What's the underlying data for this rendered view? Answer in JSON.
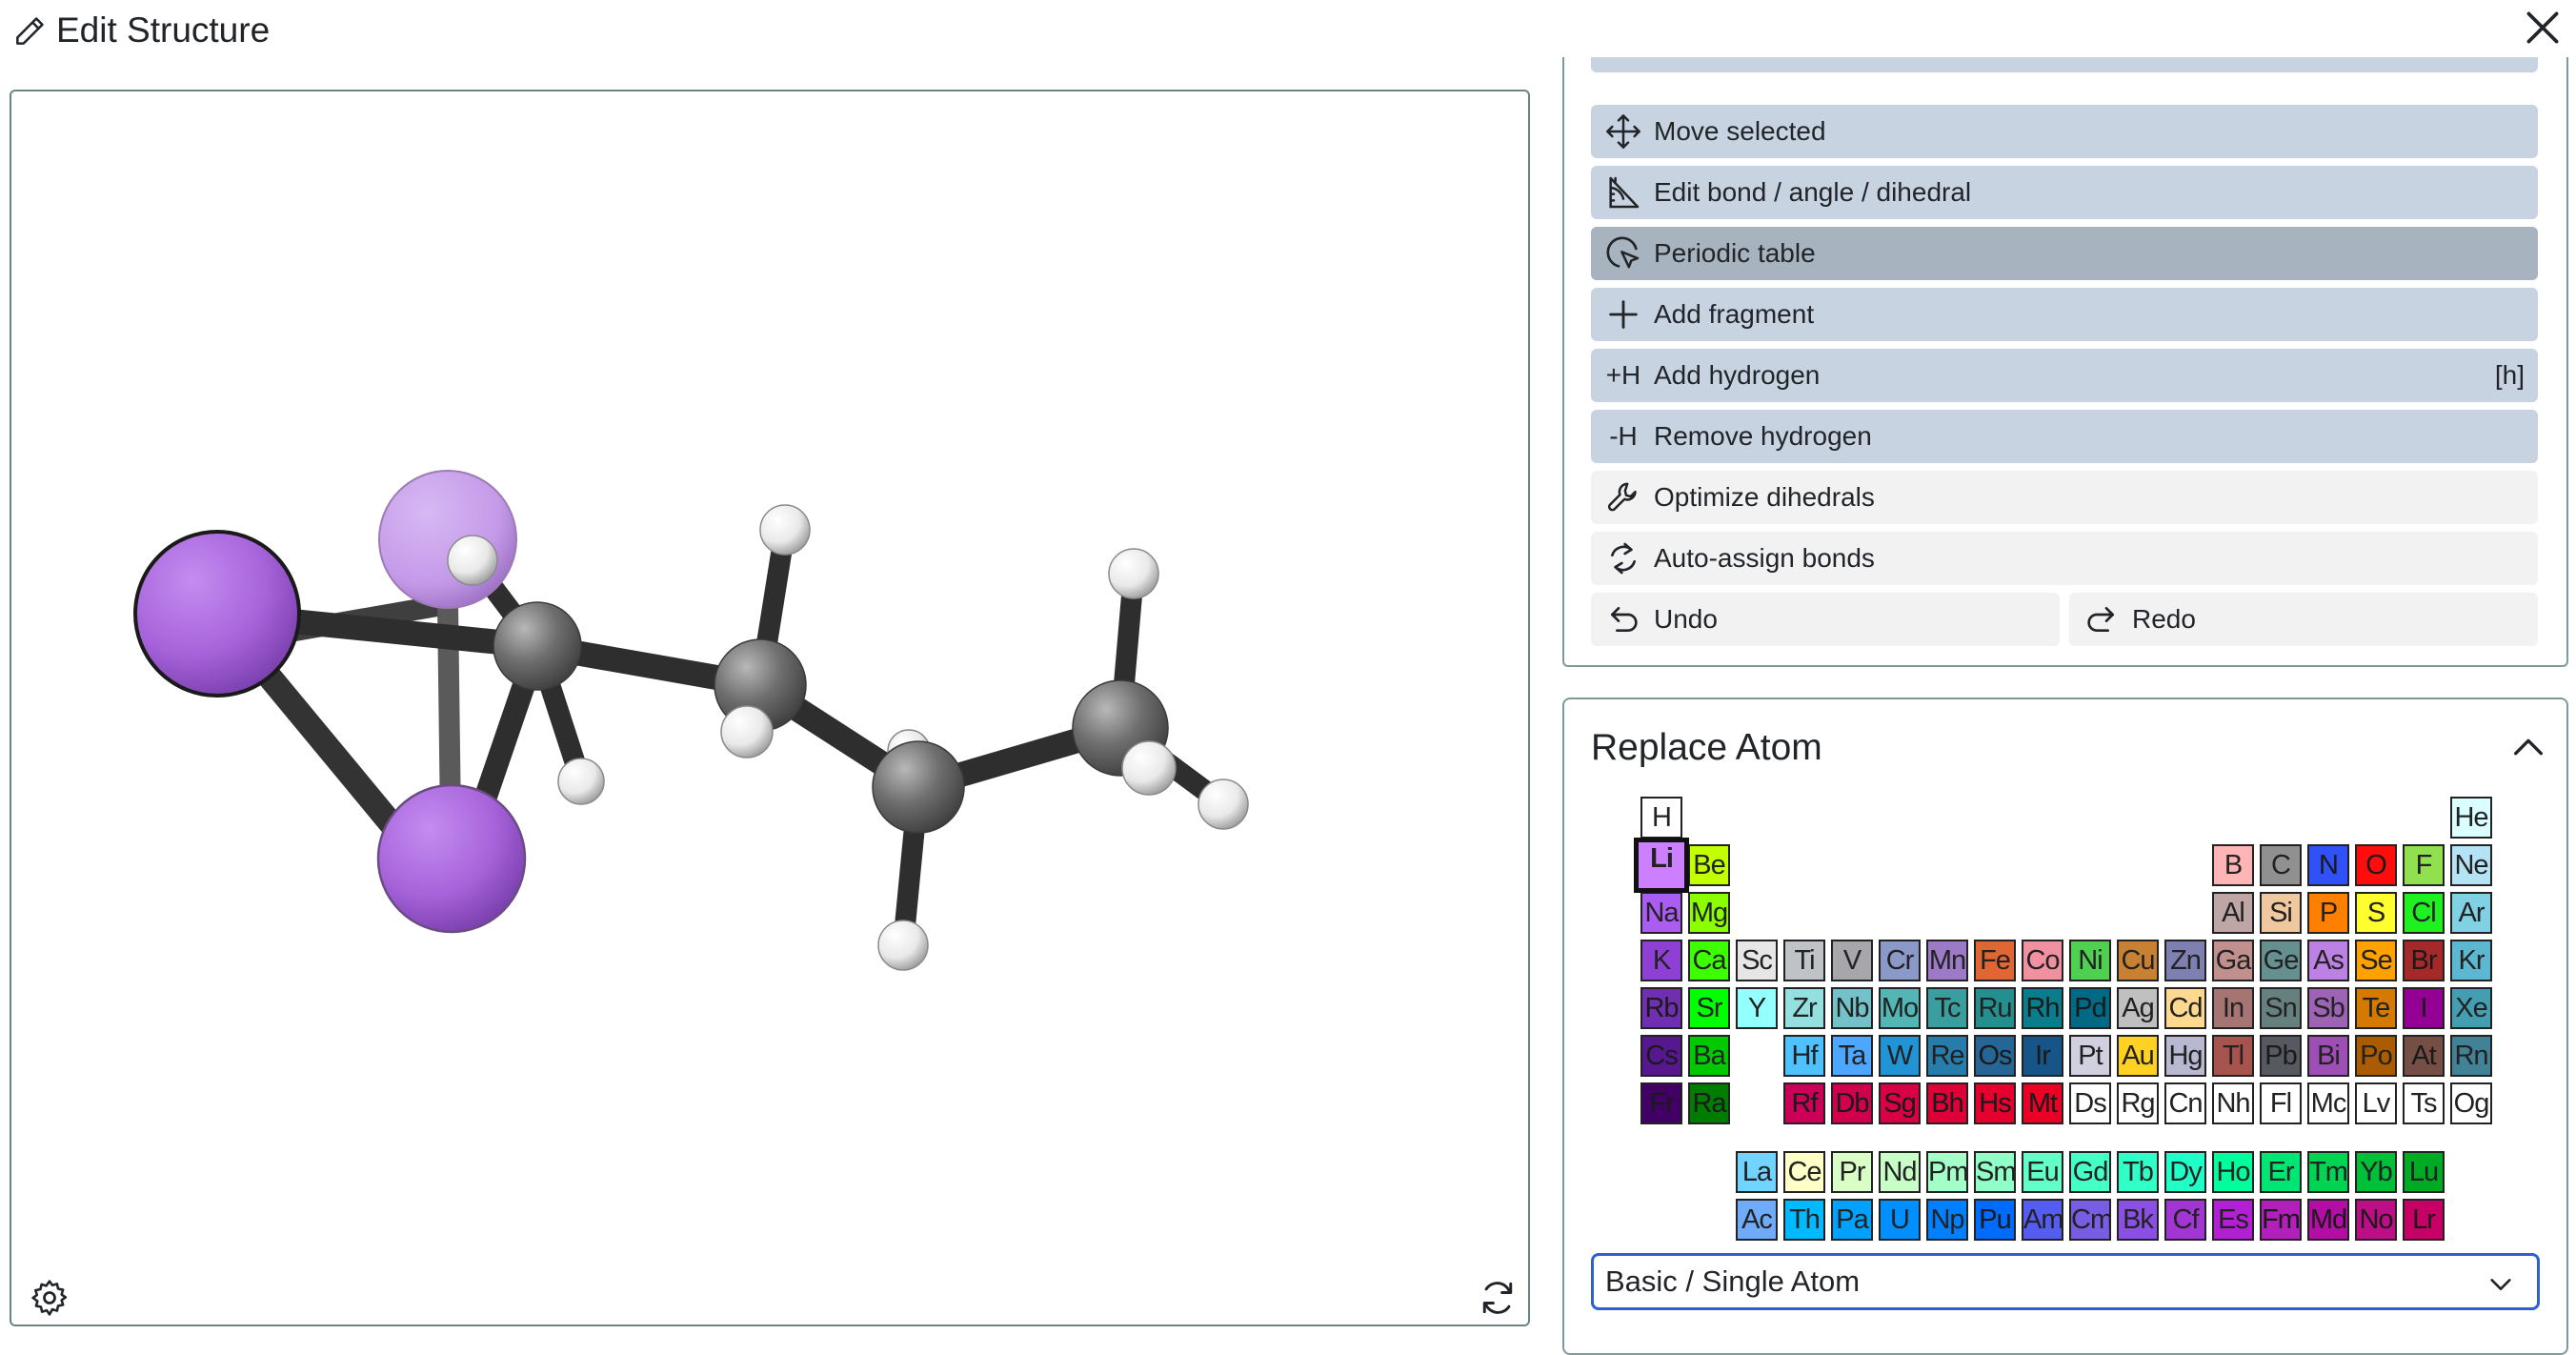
{
  "dialog": {
    "title": "Edit Structure",
    "close_icon": "close-icon",
    "title_icon": "pencil-icon"
  },
  "viewer": {
    "settings_icon": "gear-icon",
    "reset_icon": "refresh-icon"
  },
  "tools": [
    {
      "label": "Move selected",
      "icon": "move-icon",
      "state": "normal"
    },
    {
      "label": "Edit bond / angle / dihedral",
      "icon": "angle-icon",
      "state": "normal"
    },
    {
      "label": "Periodic table",
      "icon": "cursor-circle-icon",
      "state": "active"
    },
    {
      "label": "Add fragment",
      "icon": "plus-icon",
      "state": "normal"
    },
    {
      "label": "Add hydrogen",
      "icon": "add-hydrogen-icon",
      "icon_text": "+H",
      "shortcut": "[h]",
      "state": "normal"
    },
    {
      "label": "Remove hydrogen",
      "icon": "remove-hydrogen-icon",
      "icon_text": "-H",
      "state": "normal"
    },
    {
      "label": "Optimize dihedrals",
      "icon": "wrench-icon",
      "state": "light"
    },
    {
      "label": "Auto-assign bonds",
      "icon": "cycle-icon",
      "state": "light"
    }
  ],
  "history": {
    "undo_label": "Undo",
    "redo_label": "Redo"
  },
  "replace_atom": {
    "title": "Replace Atom",
    "selected_element": "Li",
    "mode_value": "Basic / Single Atom",
    "elements": [
      {
        "s": "H",
        "r": 0,
        "c": 0,
        "bg": "#ffffff"
      },
      {
        "s": "He",
        "r": 0,
        "c": 17,
        "bg": "#d9ffff"
      },
      {
        "s": "Li",
        "r": 1,
        "c": 0,
        "bg": "#cc80ff"
      },
      {
        "s": "Be",
        "r": 1,
        "c": 1,
        "bg": "#c2ff00"
      },
      {
        "s": "B",
        "r": 1,
        "c": 12,
        "bg": "#ffb5b5"
      },
      {
        "s": "C",
        "r": 1,
        "c": 13,
        "bg": "#909090"
      },
      {
        "s": "N",
        "r": 1,
        "c": 14,
        "bg": "#3050f8"
      },
      {
        "s": "O",
        "r": 1,
        "c": 15,
        "bg": "#ff0d0d"
      },
      {
        "s": "F",
        "r": 1,
        "c": 16,
        "bg": "#90e050"
      },
      {
        "s": "Ne",
        "r": 1,
        "c": 17,
        "bg": "#b3e3f5"
      },
      {
        "s": "Na",
        "r": 2,
        "c": 0,
        "bg": "#ab5cf2"
      },
      {
        "s": "Mg",
        "r": 2,
        "c": 1,
        "bg": "#8aff00"
      },
      {
        "s": "Al",
        "r": 2,
        "c": 12,
        "bg": "#bfa6a6"
      },
      {
        "s": "Si",
        "r": 2,
        "c": 13,
        "bg": "#f0c8a0"
      },
      {
        "s": "P",
        "r": 2,
        "c": 14,
        "bg": "#ff8000"
      },
      {
        "s": "S",
        "r": 2,
        "c": 15,
        "bg": "#ffff30"
      },
      {
        "s": "Cl",
        "r": 2,
        "c": 16,
        "bg": "#1ff01f"
      },
      {
        "s": "Ar",
        "r": 2,
        "c": 17,
        "bg": "#80d1e3"
      },
      {
        "s": "K",
        "r": 3,
        "c": 0,
        "bg": "#8f40d4"
      },
      {
        "s": "Ca",
        "r": 3,
        "c": 1,
        "bg": "#3dff00"
      },
      {
        "s": "Sc",
        "r": 3,
        "c": 2,
        "bg": "#e6e6e6"
      },
      {
        "s": "Ti",
        "r": 3,
        "c": 3,
        "bg": "#bfc2c7"
      },
      {
        "s": "V",
        "r": 3,
        "c": 4,
        "bg": "#a6a6ab"
      },
      {
        "s": "Cr",
        "r": 3,
        "c": 5,
        "bg": "#8a99c7"
      },
      {
        "s": "Mn",
        "r": 3,
        "c": 6,
        "bg": "#9c7ac7"
      },
      {
        "s": "Fe",
        "r": 3,
        "c": 7,
        "bg": "#e06633"
      },
      {
        "s": "Co",
        "r": 3,
        "c": 8,
        "bg": "#f090a0"
      },
      {
        "s": "Ni",
        "r": 3,
        "c": 9,
        "bg": "#50d050"
      },
      {
        "s": "Cu",
        "r": 3,
        "c": 10,
        "bg": "#c88033"
      },
      {
        "s": "Zn",
        "r": 3,
        "c": 11,
        "bg": "#7d80b0"
      },
      {
        "s": "Ga",
        "r": 3,
        "c": 12,
        "bg": "#c28f8f"
      },
      {
        "s": "Ge",
        "r": 3,
        "c": 13,
        "bg": "#668f8f"
      },
      {
        "s": "As",
        "r": 3,
        "c": 14,
        "bg": "#bd80e3"
      },
      {
        "s": "Se",
        "r": 3,
        "c": 15,
        "bg": "#ffa100"
      },
      {
        "s": "Br",
        "r": 3,
        "c": 16,
        "bg": "#a62929"
      },
      {
        "s": "Kr",
        "r": 3,
        "c": 17,
        "bg": "#5cb8d1"
      },
      {
        "s": "Rb",
        "r": 4,
        "c": 0,
        "bg": "#702eb0"
      },
      {
        "s": "Sr",
        "r": 4,
        "c": 1,
        "bg": "#00ff00"
      },
      {
        "s": "Y",
        "r": 4,
        "c": 2,
        "bg": "#94ffff"
      },
      {
        "s": "Zr",
        "r": 4,
        "c": 3,
        "bg": "#94e0e0"
      },
      {
        "s": "Nb",
        "r": 4,
        "c": 4,
        "bg": "#73c2c9"
      },
      {
        "s": "Mo",
        "r": 4,
        "c": 5,
        "bg": "#54b5b5"
      },
      {
        "s": "Tc",
        "r": 4,
        "c": 6,
        "bg": "#3b9e9e"
      },
      {
        "s": "Ru",
        "r": 4,
        "c": 7,
        "bg": "#248f8f"
      },
      {
        "s": "Rh",
        "r": 4,
        "c": 8,
        "bg": "#0a7d8c"
      },
      {
        "s": "Pd",
        "r": 4,
        "c": 9,
        "bg": "#006985"
      },
      {
        "s": "Ag",
        "r": 4,
        "c": 10,
        "bg": "#c0c0c0"
      },
      {
        "s": "Cd",
        "r": 4,
        "c": 11,
        "bg": "#ffd98f"
      },
      {
        "s": "In",
        "r": 4,
        "c": 12,
        "bg": "#a67573"
      },
      {
        "s": "Sn",
        "r": 4,
        "c": 13,
        "bg": "#668080"
      },
      {
        "s": "Sb",
        "r": 4,
        "c": 14,
        "bg": "#9e63b5"
      },
      {
        "s": "Te",
        "r": 4,
        "c": 15,
        "bg": "#d47a00"
      },
      {
        "s": "I",
        "r": 4,
        "c": 16,
        "bg": "#940094"
      },
      {
        "s": "Xe",
        "r": 4,
        "c": 17,
        "bg": "#429eb0"
      },
      {
        "s": "Cs",
        "r": 5,
        "c": 0,
        "bg": "#57178f"
      },
      {
        "s": "Ba",
        "r": 5,
        "c": 1,
        "bg": "#00c900"
      },
      {
        "s": "Hf",
        "r": 5,
        "c": 3,
        "bg": "#4dc2ff"
      },
      {
        "s": "Ta",
        "r": 5,
        "c": 4,
        "bg": "#4da6ff"
      },
      {
        "s": "W",
        "r": 5,
        "c": 5,
        "bg": "#2194d6"
      },
      {
        "s": "Re",
        "r": 5,
        "c": 6,
        "bg": "#267dab"
      },
      {
        "s": "Os",
        "r": 5,
        "c": 7,
        "bg": "#266696"
      },
      {
        "s": "Ir",
        "r": 5,
        "c": 8,
        "bg": "#175487"
      },
      {
        "s": "Pt",
        "r": 5,
        "c": 9,
        "bg": "#d0d0e0"
      },
      {
        "s": "Au",
        "r": 5,
        "c": 10,
        "bg": "#ffd123"
      },
      {
        "s": "Hg",
        "r": 5,
        "c": 11,
        "bg": "#b8b8d0"
      },
      {
        "s": "Tl",
        "r": 5,
        "c": 12,
        "bg": "#a6544d"
      },
      {
        "s": "Pb",
        "r": 5,
        "c": 13,
        "bg": "#575961"
      },
      {
        "s": "Bi",
        "r": 5,
        "c": 14,
        "bg": "#9e4fb5"
      },
      {
        "s": "Po",
        "r": 5,
        "c": 15,
        "bg": "#ab5c00"
      },
      {
        "s": "At",
        "r": 5,
        "c": 16,
        "bg": "#754f45"
      },
      {
        "s": "Rn",
        "r": 5,
        "c": 17,
        "bg": "#428296"
      },
      {
        "s": "Fr",
        "r": 6,
        "c": 0,
        "bg": "#420066"
      },
      {
        "s": "Ra",
        "r": 6,
        "c": 1,
        "bg": "#007d00"
      },
      {
        "s": "Rf",
        "r": 6,
        "c": 3,
        "bg": "#cc0059"
      },
      {
        "s": "Db",
        "r": 6,
        "c": 4,
        "bg": "#d1004f"
      },
      {
        "s": "Sg",
        "r": 6,
        "c": 5,
        "bg": "#d90045"
      },
      {
        "s": "Bh",
        "r": 6,
        "c": 6,
        "bg": "#e00038"
      },
      {
        "s": "Hs",
        "r": 6,
        "c": 7,
        "bg": "#e6002e"
      },
      {
        "s": "Mt",
        "r": 6,
        "c": 8,
        "bg": "#eb0026"
      },
      {
        "s": "Ds",
        "r": 6,
        "c": 9,
        "bg": "#ffffff"
      },
      {
        "s": "Rg",
        "r": 6,
        "c": 10,
        "bg": "#ffffff"
      },
      {
        "s": "Cn",
        "r": 6,
        "c": 11,
        "bg": "#ffffff"
      },
      {
        "s": "Nh",
        "r": 6,
        "c": 12,
        "bg": "#ffffff"
      },
      {
        "s": "Fl",
        "r": 6,
        "c": 13,
        "bg": "#ffffff"
      },
      {
        "s": "Mc",
        "r": 6,
        "c": 14,
        "bg": "#ffffff"
      },
      {
        "s": "Lv",
        "r": 6,
        "c": 15,
        "bg": "#ffffff"
      },
      {
        "s": "Ts",
        "r": 6,
        "c": 16,
        "bg": "#ffffff"
      },
      {
        "s": "Og",
        "r": 6,
        "c": 17,
        "bg": "#ffffff"
      },
      {
        "s": "La",
        "r": 7,
        "c": 2,
        "bg": "#70d4ff"
      },
      {
        "s": "Ce",
        "r": 7,
        "c": 3,
        "bg": "#ffffc7"
      },
      {
        "s": "Pr",
        "r": 7,
        "c": 4,
        "bg": "#d9ffc7"
      },
      {
        "s": "Nd",
        "r": 7,
        "c": 5,
        "bg": "#c7ffc7"
      },
      {
        "s": "Pm",
        "r": 7,
        "c": 6,
        "bg": "#a3ffc7"
      },
      {
        "s": "Sm",
        "r": 7,
        "c": 7,
        "bg": "#8fffc7"
      },
      {
        "s": "Eu",
        "r": 7,
        "c": 8,
        "bg": "#61ffc7"
      },
      {
        "s": "Gd",
        "r": 7,
        "c": 9,
        "bg": "#45ffc7"
      },
      {
        "s": "Tb",
        "r": 7,
        "c": 10,
        "bg": "#30ffc7"
      },
      {
        "s": "Dy",
        "r": 7,
        "c": 11,
        "bg": "#1fffc7"
      },
      {
        "s": "Ho",
        "r": 7,
        "c": 12,
        "bg": "#00ff9c"
      },
      {
        "s": "Er",
        "r": 7,
        "c": 13,
        "bg": "#00e675"
      },
      {
        "s": "Tm",
        "r": 7,
        "c": 14,
        "bg": "#00d452"
      },
      {
        "s": "Yb",
        "r": 7,
        "c": 15,
        "bg": "#00bf38"
      },
      {
        "s": "Lu",
        "r": 7,
        "c": 16,
        "bg": "#00ab24"
      },
      {
        "s": "Ac",
        "r": 8,
        "c": 2,
        "bg": "#70abfa"
      },
      {
        "s": "Th",
        "r": 8,
        "c": 3,
        "bg": "#00baff"
      },
      {
        "s": "Pa",
        "r": 8,
        "c": 4,
        "bg": "#00a1ff"
      },
      {
        "s": "U",
        "r": 8,
        "c": 5,
        "bg": "#008fff"
      },
      {
        "s": "Np",
        "r": 8,
        "c": 6,
        "bg": "#0080ff"
      },
      {
        "s": "Pu",
        "r": 8,
        "c": 7,
        "bg": "#006bff"
      },
      {
        "s": "Am",
        "r": 8,
        "c": 8,
        "bg": "#545cf2"
      },
      {
        "s": "Cm",
        "r": 8,
        "c": 9,
        "bg": "#785ce3"
      },
      {
        "s": "Bk",
        "r": 8,
        "c": 10,
        "bg": "#8a4fe3"
      },
      {
        "s": "Cf",
        "r": 8,
        "c": 11,
        "bg": "#a136d4"
      },
      {
        "s": "Es",
        "r": 8,
        "c": 12,
        "bg": "#b31fd4"
      },
      {
        "s": "Fm",
        "r": 8,
        "c": 13,
        "bg": "#b31fba"
      },
      {
        "s": "Md",
        "r": 8,
        "c": 14,
        "bg": "#b30da6"
      },
      {
        "s": "No",
        "r": 8,
        "c": 15,
        "bg": "#bd0d87"
      },
      {
        "s": "Lr",
        "r": 8,
        "c": 16,
        "bg": "#c70066"
      }
    ]
  },
  "colors": {
    "tool_bg": "#c8d3e2",
    "tool_active_bg": "#a8b3c0",
    "tool_light_bg": "#f2f2f2",
    "select_border": "#2f5fd0",
    "carbon": "#6f6f6f",
    "hydrogen": "#f2f2f2",
    "lithium": "#a95ed8"
  }
}
